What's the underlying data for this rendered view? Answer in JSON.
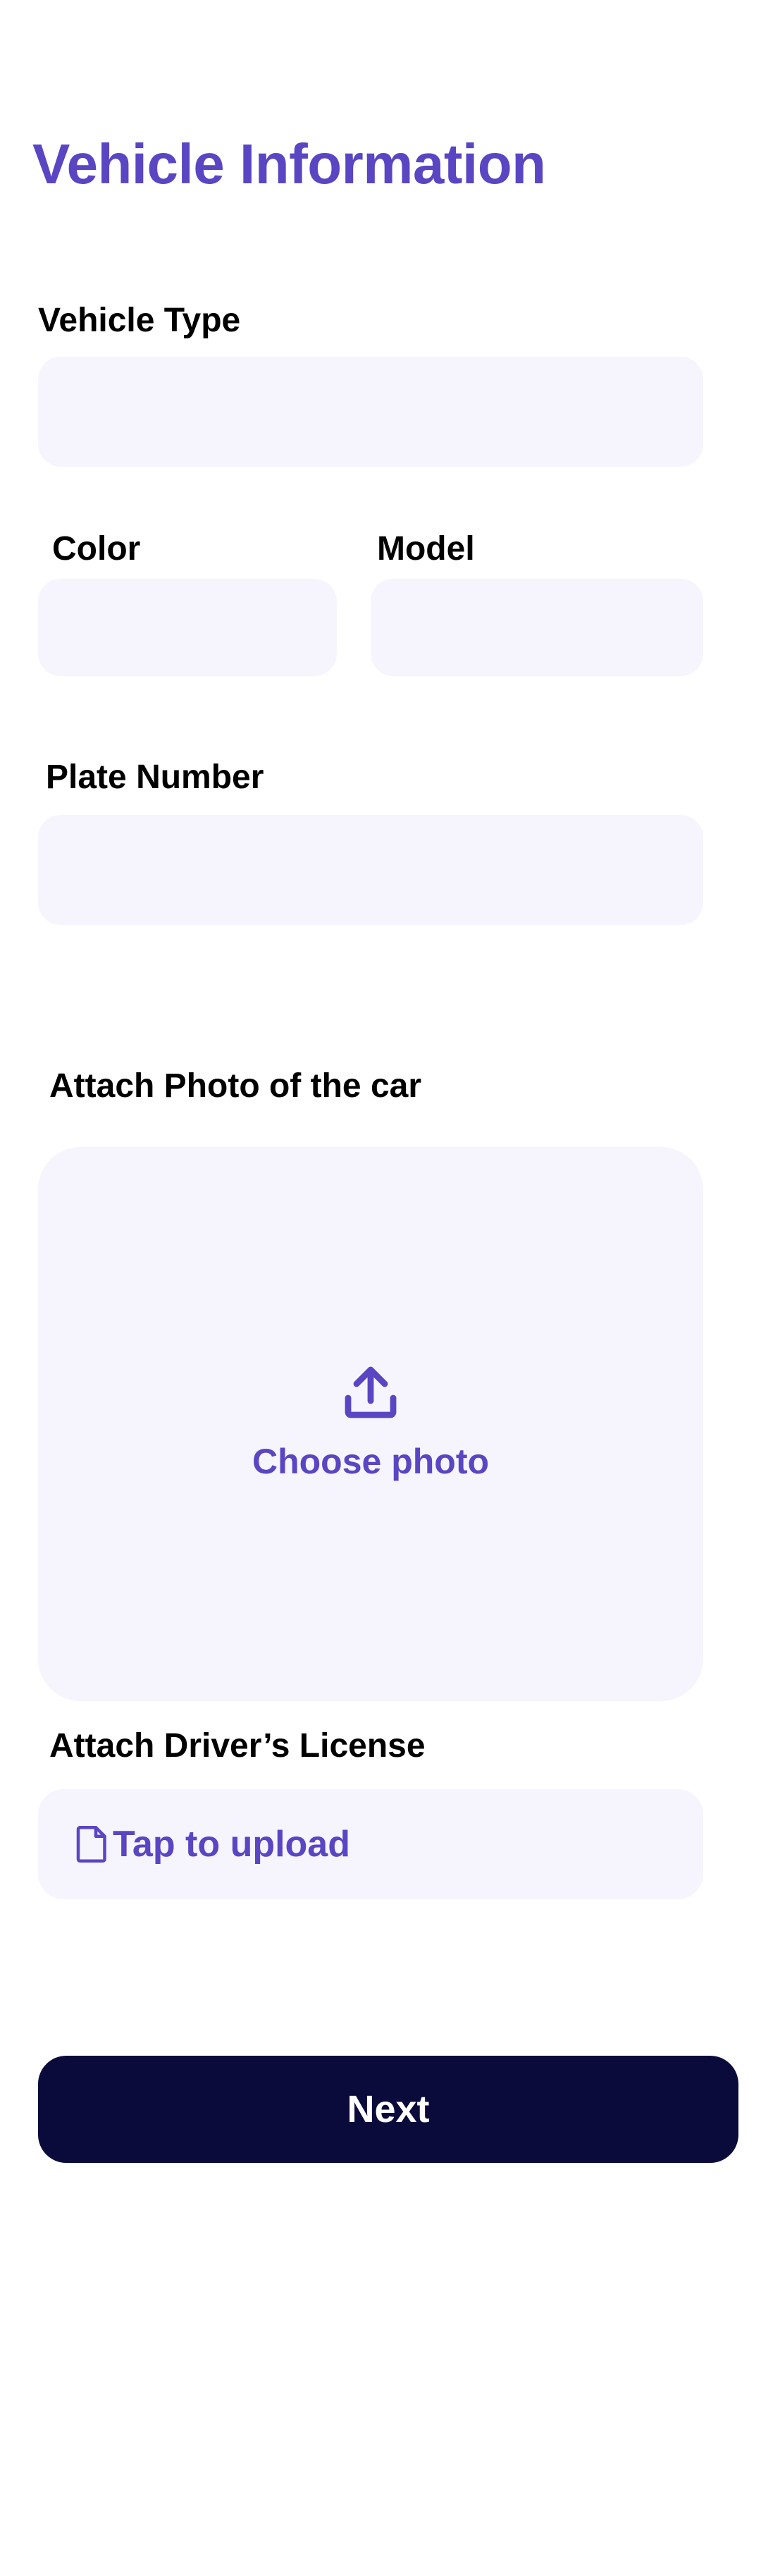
{
  "header": {
    "title": "Vehicle Information"
  },
  "form": {
    "vehicle_type": {
      "label": "Vehicle Type",
      "value": "",
      "placeholder": ""
    },
    "color": {
      "label": "Color",
      "value": "",
      "placeholder": ""
    },
    "model": {
      "label": "Model",
      "value": "",
      "placeholder": ""
    },
    "plate_number": {
      "label": "Plate Number",
      "value": "",
      "placeholder": ""
    }
  },
  "car_photo": {
    "label": "Attach Photo of the car",
    "action_label": "Choose photo",
    "icon": "upload-icon"
  },
  "drivers_license": {
    "label": "Attach Driver’s License",
    "action_label": "Tap to upload",
    "icon": "file-icon"
  },
  "footer": {
    "next_label": "Next"
  },
  "colors": {
    "accent": "#5a45c3",
    "field_background": "#f6f5fd",
    "primary_button": "#0b0b3b"
  }
}
